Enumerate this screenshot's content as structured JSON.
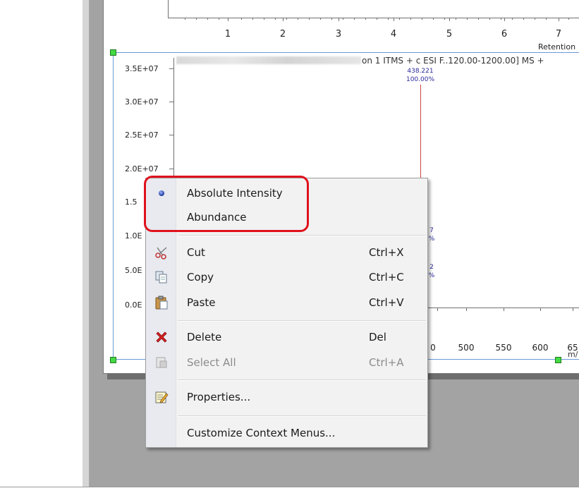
{
  "top_chart": {
    "x_ticks": [
      "1",
      "2",
      "3",
      "4",
      "5",
      "6",
      "7"
    ],
    "axis_title": "Retention"
  },
  "spectrum": {
    "title": "on 1 ITMS + c ESI F..120.00-1200.00] MS +",
    "y_ticks": [
      "3.5E+07",
      "3.0E+07",
      "2.5E+07",
      "2.0E+07",
      "1.5",
      "1.0E",
      "5.0E",
      "0.0E"
    ],
    "peak": {
      "mz": "438.221",
      "relative": "100.00%"
    },
    "partial_peak_labels": [
      "7",
      "%",
      "2",
      "%"
    ],
    "x_ticks": [
      "0",
      "500",
      "550",
      "600",
      "65"
    ],
    "x_axis_title": "m/"
  },
  "context_menu": {
    "colors": {
      "highlight_border": "#e0111c",
      "selection_handle": "#43d943"
    },
    "items": [
      {
        "label": "Absolute Intensity",
        "shortcut": "",
        "icon": "radio-selected-icon",
        "checked": true
      },
      {
        "label": "Abundance",
        "shortcut": "",
        "icon": ""
      },
      {
        "label": "Cut",
        "shortcut": "Ctrl+X",
        "icon": "scissors-icon"
      },
      {
        "label": "Copy",
        "shortcut": "Ctrl+C",
        "icon": "copy-icon"
      },
      {
        "label": "Paste",
        "shortcut": "Ctrl+V",
        "icon": "paste-icon"
      },
      {
        "label": "Delete",
        "shortcut": "Del",
        "icon": "delete-x-icon"
      },
      {
        "label": "Select All",
        "shortcut": "Ctrl+A",
        "icon": "select-all-icon",
        "disabled": true
      },
      {
        "label": "Properties...",
        "shortcut": "",
        "icon": "properties-icon"
      },
      {
        "label": "Customize Context Menus...",
        "shortcut": "",
        "icon": ""
      }
    ]
  }
}
